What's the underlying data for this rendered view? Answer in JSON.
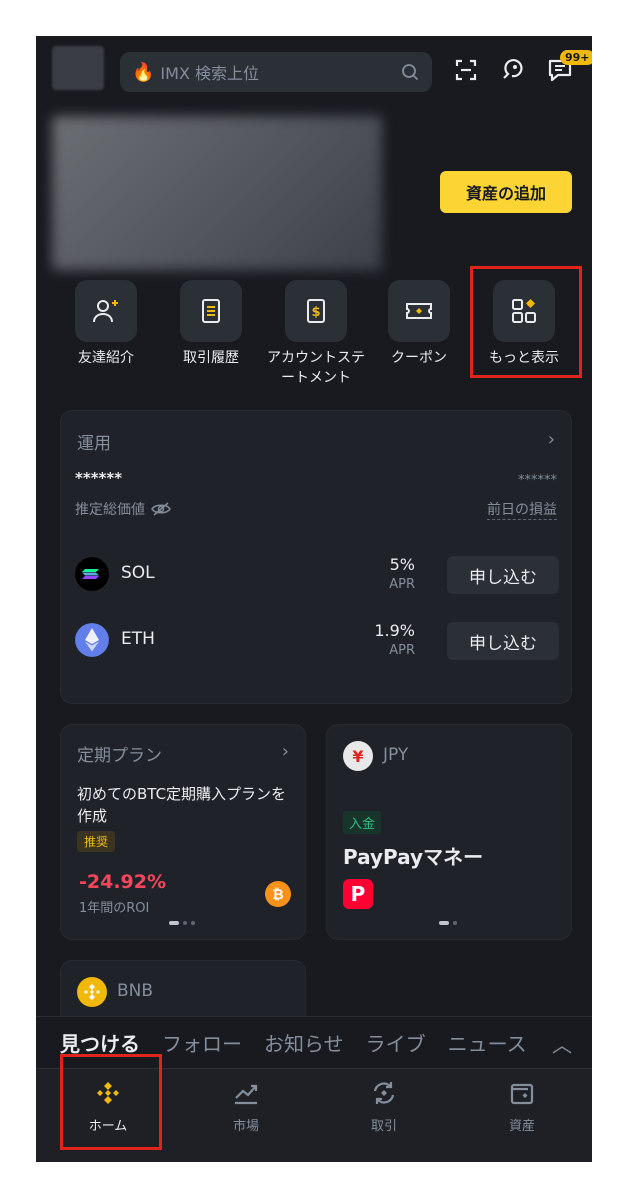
{
  "header": {
    "search_placeholder": "IMX 検索上位",
    "badge": "99+"
  },
  "balance": {
    "add_asset_label": "資産の追加"
  },
  "quick_actions": [
    {
      "label": "友達紹介",
      "icon": "add-person-icon"
    },
    {
      "label": "取引履歴",
      "icon": "document-icon"
    },
    {
      "label": "アカウントステートメント",
      "icon": "statement-icon"
    },
    {
      "label": "クーポン",
      "icon": "ticket-icon"
    },
    {
      "label": "もっと表示",
      "icon": "grid-more-icon"
    }
  ],
  "earn": {
    "title": "運用",
    "masked_total": "******",
    "masked_pnl": "******",
    "total_label": "推定総価値",
    "pnl_label": "前日の損益",
    "items": [
      {
        "coin": "SOL",
        "apr": "5%",
        "apr_label": "APR",
        "button": "申し込む"
      },
      {
        "coin": "ETH",
        "apr": "1.9%",
        "apr_label": "APR",
        "button": "申し込む"
      }
    ]
  },
  "plan": {
    "title": "定期プラン",
    "description": "初めてのBTC定期購入プランを作成",
    "tag": "推奨",
    "roi": "-24.92%",
    "roi_label": "1年間のROI",
    "coin_symbol": "₿"
  },
  "jpy": {
    "symbol": "¥",
    "currency": "JPY",
    "tag": "入金",
    "name": "PayPayマネー",
    "icon_letter": "P"
  },
  "bnb": {
    "currency": "BNB"
  },
  "feed_tabs": [
    "見つける",
    "フォロー",
    "お知らせ",
    "ライブ",
    "ニュース"
  ],
  "bottom_nav": [
    {
      "label": "ホーム",
      "icon": "home-binance-icon"
    },
    {
      "label": "市場",
      "icon": "market-chart-icon"
    },
    {
      "label": "取引",
      "icon": "trade-icon"
    },
    {
      "label": "資産",
      "icon": "wallet-icon"
    }
  ],
  "colors": {
    "background": "#181a20",
    "card": "#1f2228",
    "accent": "#fcd535",
    "negative": "#f6465d",
    "positive": "#2ebd85",
    "highlight_box": "#e0241b"
  }
}
